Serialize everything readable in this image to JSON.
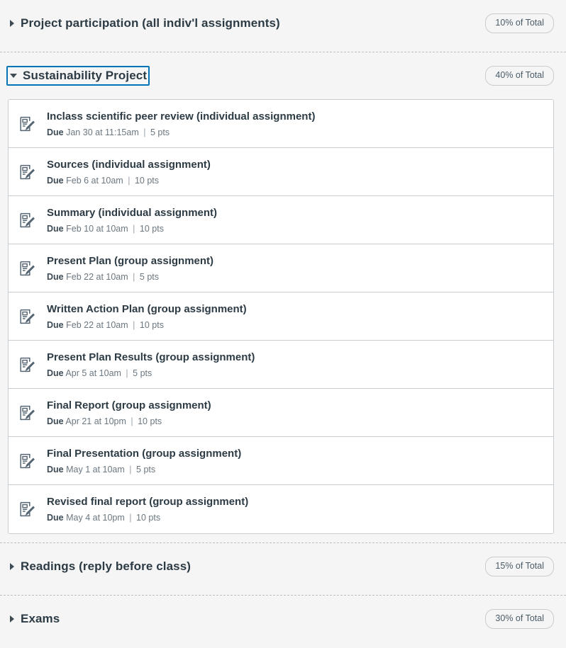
{
  "groups": [
    {
      "id": "project-participation",
      "title": "Project participation (all indiv'l assignments)",
      "weight": "10% of Total",
      "expanded": false,
      "focused": false,
      "caret_icon": "caret-right-icon",
      "assignments": []
    },
    {
      "id": "sustainability-project",
      "title": "Sustainability Project",
      "weight": "40% of Total",
      "expanded": true,
      "focused": true,
      "caret_icon": "caret-down-icon",
      "assignments": [
        {
          "title": "Inclass scientific peer review (individual assignment)",
          "due_label": "Due",
          "due_date": "Jan 30 at 11:15am",
          "separator": "|",
          "points": "5 pts",
          "icon": "assignment-icon"
        },
        {
          "title": "Sources (individual assignment)",
          "due_label": "Due",
          "due_date": "Feb 6 at 10am",
          "separator": "|",
          "points": "10 pts",
          "icon": "assignment-icon"
        },
        {
          "title": "Summary (individual assignment)",
          "due_label": "Due",
          "due_date": "Feb 10 at 10am",
          "separator": "|",
          "points": "10 pts",
          "icon": "assignment-icon"
        },
        {
          "title": "Present Plan (group assignment)",
          "due_label": "Due",
          "due_date": "Feb 22 at 10am",
          "separator": "|",
          "points": "5 pts",
          "icon": "assignment-icon"
        },
        {
          "title": "Written Action Plan (group assignment)",
          "due_label": "Due",
          "due_date": "Feb 22 at 10am",
          "separator": "|",
          "points": "10 pts",
          "icon": "assignment-icon"
        },
        {
          "title": "Present Plan Results (group assignment)",
          "due_label": "Due",
          "due_date": "Apr 5 at 10am",
          "separator": "|",
          "points": "5 pts",
          "icon": "assignment-icon"
        },
        {
          "title": "Final Report (group assignment)",
          "due_label": "Due",
          "due_date": "Apr 21 at 10pm",
          "separator": "|",
          "points": "10 pts",
          "icon": "assignment-icon"
        },
        {
          "title": "Final Presentation (group assignment)",
          "due_label": "Due",
          "due_date": "May 1 at 10am",
          "separator": "|",
          "points": "5 pts",
          "icon": "assignment-icon"
        },
        {
          "title": "Revised final report (group assignment)",
          "due_label": "Due",
          "due_date": "May 4 at 10pm",
          "separator": "|",
          "points": "10 pts",
          "icon": "assignment-icon"
        }
      ]
    },
    {
      "id": "readings",
      "title": "Readings (reply before class)",
      "weight": "15% of Total",
      "expanded": false,
      "focused": false,
      "caret_icon": "caret-right-icon",
      "assignments": []
    },
    {
      "id": "exams",
      "title": "Exams",
      "weight": "30% of Total",
      "expanded": false,
      "focused": false,
      "caret_icon": "caret-right-icon",
      "assignments": []
    }
  ],
  "colors": {
    "page_background": "#f5f5f5",
    "row_background": "#ffffff",
    "border": "#c7cdd1",
    "text_primary": "#2d3b45",
    "text_secondary": "#6b7780",
    "focus_ring": "#0374b5",
    "divider_dashed": "#b8c0c6"
  }
}
